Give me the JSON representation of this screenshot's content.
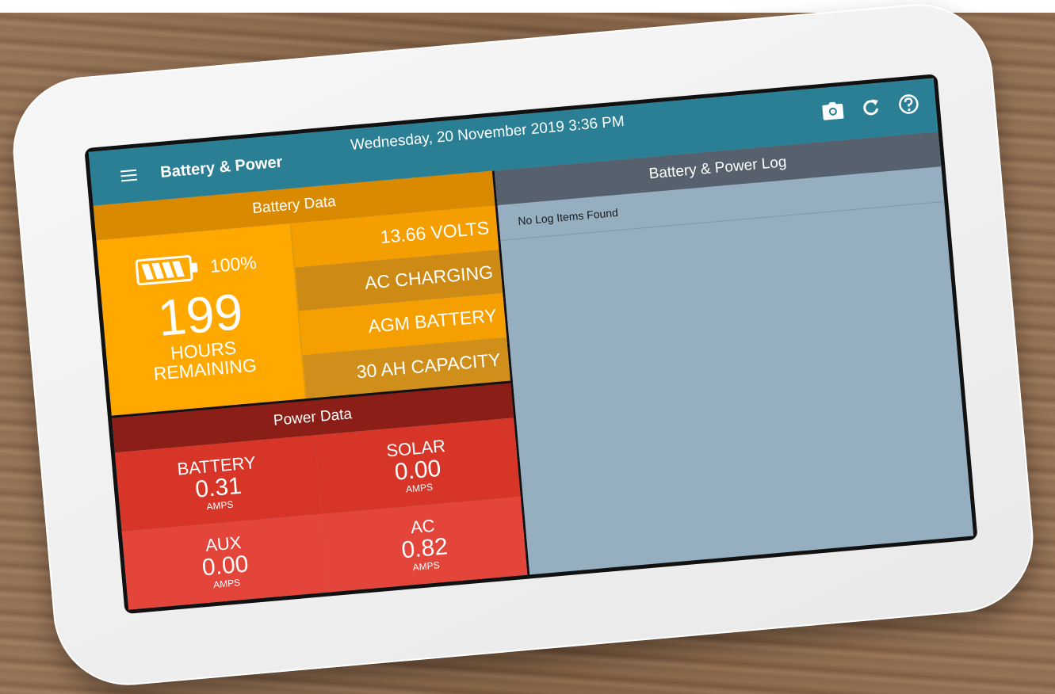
{
  "header": {
    "title": "Battery & Power",
    "datetime": "Wednesday, 20 November 2019 3:36 PM",
    "actions": [
      {
        "name": "camera-icon"
      },
      {
        "name": "refresh-icon"
      },
      {
        "name": "help-icon"
      }
    ]
  },
  "battery": {
    "section_label": "Battery Data",
    "percent": "100%",
    "charge_level": 1.0,
    "hours_value": "199",
    "hours_label_line1": "HOURS",
    "hours_label_line2": "REMAINING",
    "stats": [
      "13.66 VOLTS",
      "AC CHARGING",
      "AGM BATTERY",
      "30 AH CAPACITY"
    ]
  },
  "power": {
    "section_label": "Power Data",
    "cells": [
      {
        "label": "BATTERY",
        "value": "0.31",
        "unit": "AMPS"
      },
      {
        "label": "SOLAR",
        "value": "0.00",
        "unit": "AMPS"
      },
      {
        "label": "AUX",
        "value": "0.00",
        "unit": "AMPS"
      },
      {
        "label": "AC",
        "value": "0.82",
        "unit": "AMPS"
      }
    ]
  },
  "log": {
    "title": "Battery & Power Log",
    "empty_message": "No Log Items Found"
  },
  "colors": {
    "appbar": "#2a7f95",
    "battery_accent": "#ffa800",
    "power_accent": "#d73528",
    "log_header": "#56616d",
    "log_background": "#95afc1"
  }
}
